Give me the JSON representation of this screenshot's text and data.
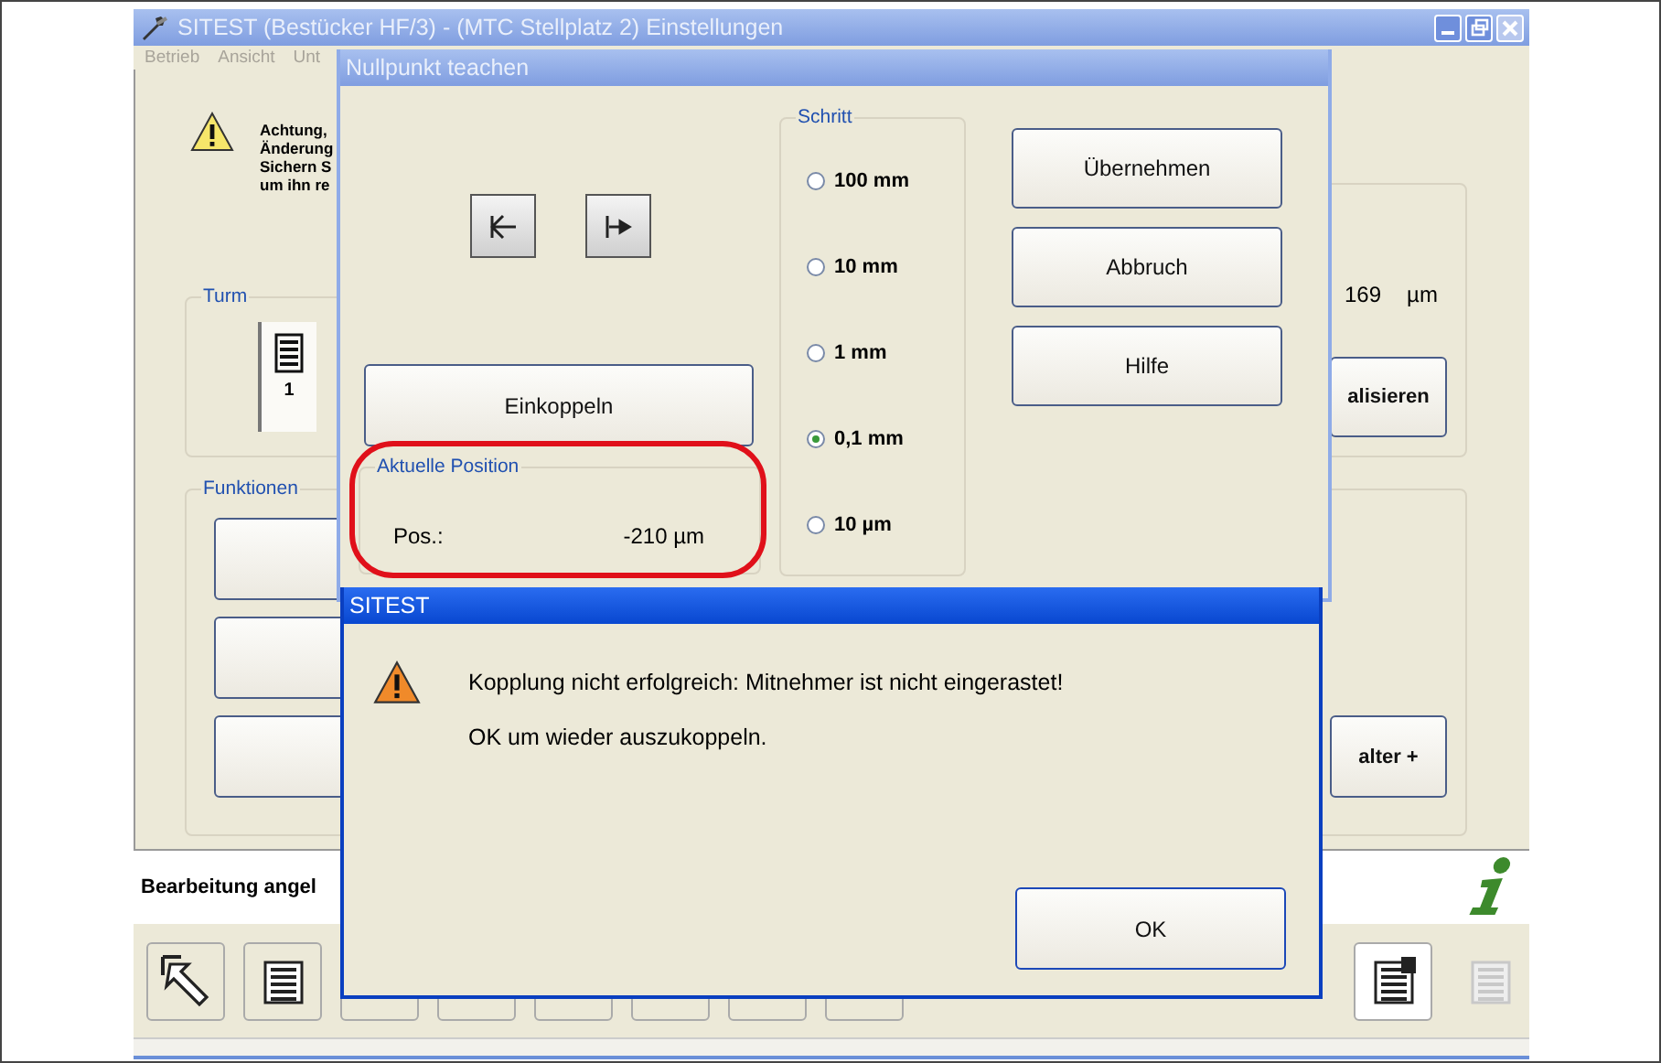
{
  "main_window": {
    "title": "SITEST (Bestücker HF/3) - (MTC Stellplatz 2) Einstellungen",
    "active": false,
    "menu": [
      "Betrieb",
      "Ansicht",
      "Unt"
    ],
    "warning_lines": [
      "Achtung,",
      "Änderung",
      "Sichern S",
      "um ihn re"
    ],
    "turm": {
      "label": "Turm",
      "number": "1"
    },
    "funktionen": {
      "label": "Funktionen"
    },
    "reading": {
      "value": "169",
      "unit": "µm"
    },
    "right_buttons": [
      "alisieren",
      "alter +"
    ],
    "status_text": "Bearbeitung angel",
    "toolbar": [
      {
        "kind": "pointer",
        "disabled": false
      },
      {
        "kind": "list",
        "disabled": false
      },
      {
        "kind": "hidden",
        "disabled": false
      },
      {
        "kind": "hidden",
        "disabled": false
      },
      {
        "kind": "hidden",
        "disabled": false
      },
      {
        "kind": "hidden",
        "disabled": false
      },
      {
        "kind": "hidden",
        "disabled": false
      },
      {
        "kind": "hidden",
        "disabled": false
      },
      {
        "kind": "list2",
        "disabled": false
      },
      {
        "kind": "list",
        "disabled": true
      }
    ]
  },
  "teach_dialog": {
    "title": "Nullpunkt teachen",
    "active": false,
    "einkoppeln": "Einkoppeln",
    "position": {
      "label": "Aktuelle Position",
      "name": "Pos.:",
      "value": "-210 µm",
      "highlighted": true
    },
    "schritt": {
      "label": "Schritt",
      "options": [
        {
          "label": "100 mm",
          "selected": false
        },
        {
          "label": "10 mm",
          "selected": false
        },
        {
          "label": "1 mm",
          "selected": false
        },
        {
          "label": "0,1 mm",
          "selected": true
        },
        {
          "label": "10 µm",
          "selected": false
        }
      ]
    },
    "buttons": [
      "Übernehmen",
      "Abbruch",
      "Hilfe"
    ]
  },
  "message_dialog": {
    "title": "SITEST",
    "active": true,
    "lines": [
      "Kopplung nicht erfolgreich: Mitnehmer ist nicht eingerastet!",
      "OK um wieder auszukoppeln."
    ],
    "button": "OK"
  }
}
